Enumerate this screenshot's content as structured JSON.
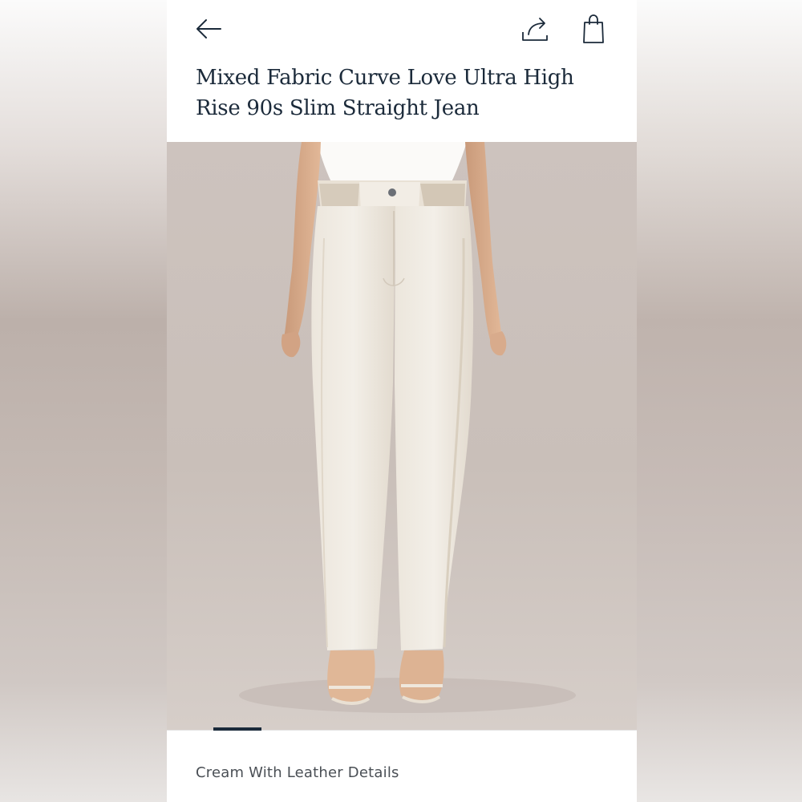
{
  "header": {
    "back_icon": "arrow-left-icon",
    "share_icon": "share-icon",
    "bag_icon": "shopping-bag-icon"
  },
  "product": {
    "title": "Mixed Fabric Curve Love Ultra High Rise 90s Slim Straight Jean",
    "color_name": "Cream With Leather Details"
  },
  "gallery": {
    "active_image": 1
  },
  "colors": {
    "text": "#1b2a3a",
    "muted_text": "#4a4f55",
    "background": "#ffffff"
  }
}
